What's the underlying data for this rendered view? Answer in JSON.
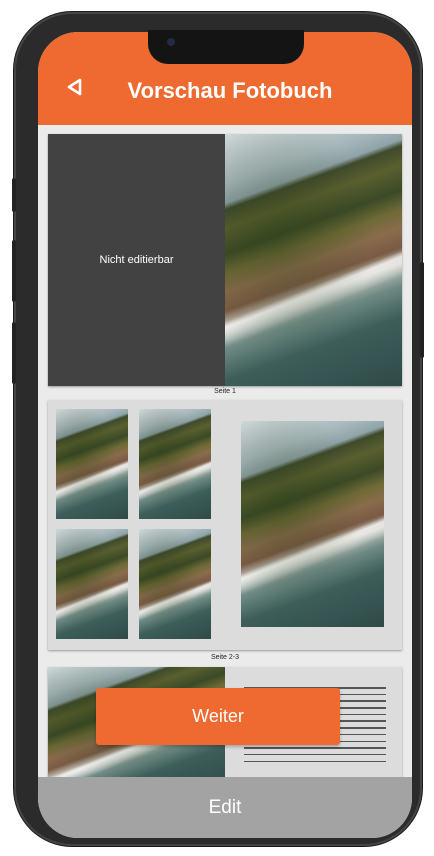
{
  "header": {
    "title": "Vorschau Fotobuch",
    "back_icon": "back-triangle-icon"
  },
  "spreads": [
    {
      "label": "Seite 1",
      "left_placeholder": "Nicht editierbar"
    },
    {
      "label": "Seite 2-3"
    }
  ],
  "buttons": {
    "weiter": "Weiter",
    "edit": "Edit"
  },
  "colors": {
    "accent": "#ee6a31",
    "edit_bar": "#a3a3a3",
    "placeholder_dark": "#424242"
  }
}
